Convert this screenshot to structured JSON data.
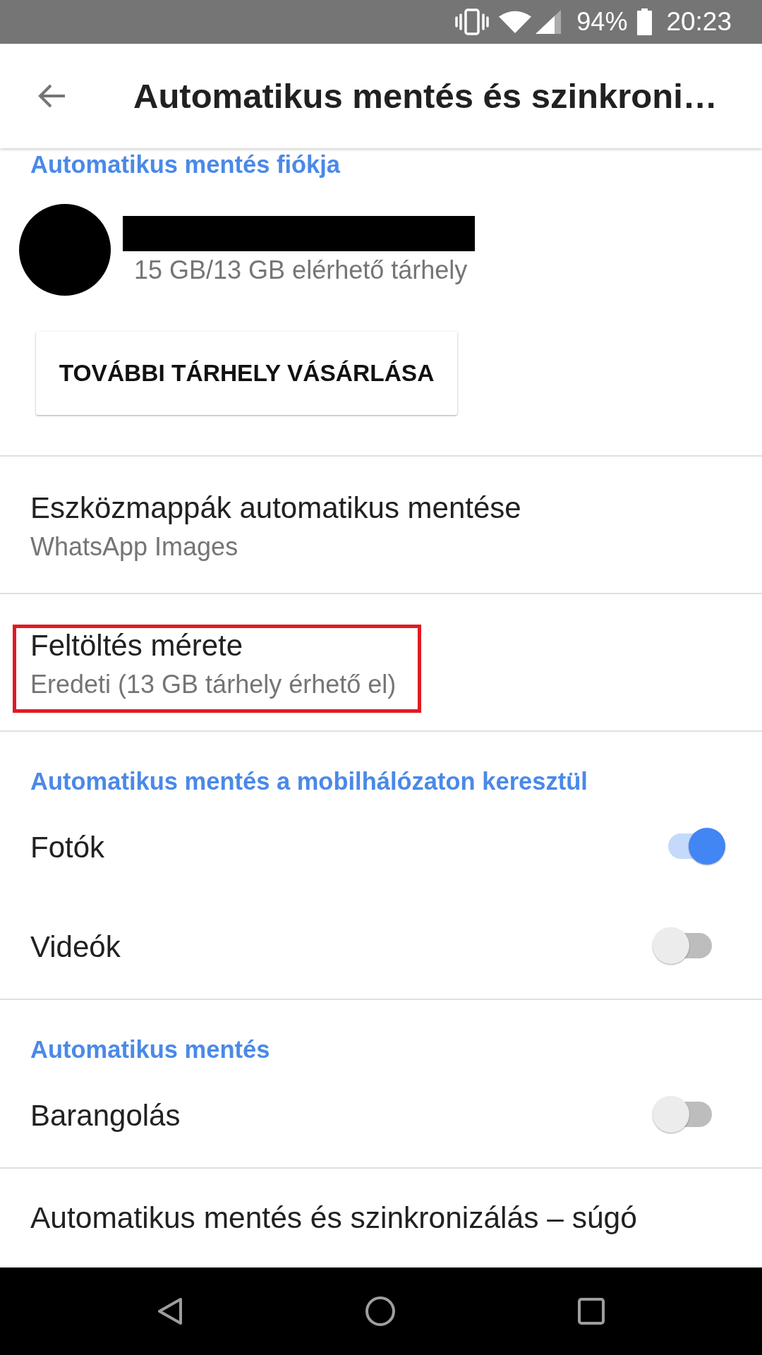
{
  "status_bar": {
    "battery": "94%",
    "time": "20:23"
  },
  "app_bar": {
    "title": "Automatikus mentés és szinkroni…"
  },
  "sections": [
    {
      "kind": "account",
      "header": "Automatikus mentés fiókja",
      "storage": "15 GB/13 GB elérhető tárhely",
      "button": "TOVÁBBI TÁRHELY VÁSÁRLÁSA"
    },
    {
      "kind": "setting",
      "title": "Eszközmappák automatikus mentése",
      "subtitle": "WhatsApp Images",
      "highlighted": false
    },
    {
      "kind": "setting",
      "title": "Feltöltés mérete",
      "subtitle": "Eredeti (13 GB tárhely érhető el)",
      "highlighted": true
    },
    {
      "kind": "toggles",
      "header": "Automatikus mentés a mobilhálózaton keresztül",
      "items": [
        {
          "label": "Fotók",
          "on": true
        },
        {
          "label": "Videók",
          "on": false
        }
      ]
    },
    {
      "kind": "toggles",
      "header": "Automatikus mentés",
      "items": [
        {
          "label": "Barangolás",
          "on": false
        }
      ]
    },
    {
      "kind": "link",
      "title": "Automatikus mentés és szinkronizálás – súgó"
    }
  ]
}
